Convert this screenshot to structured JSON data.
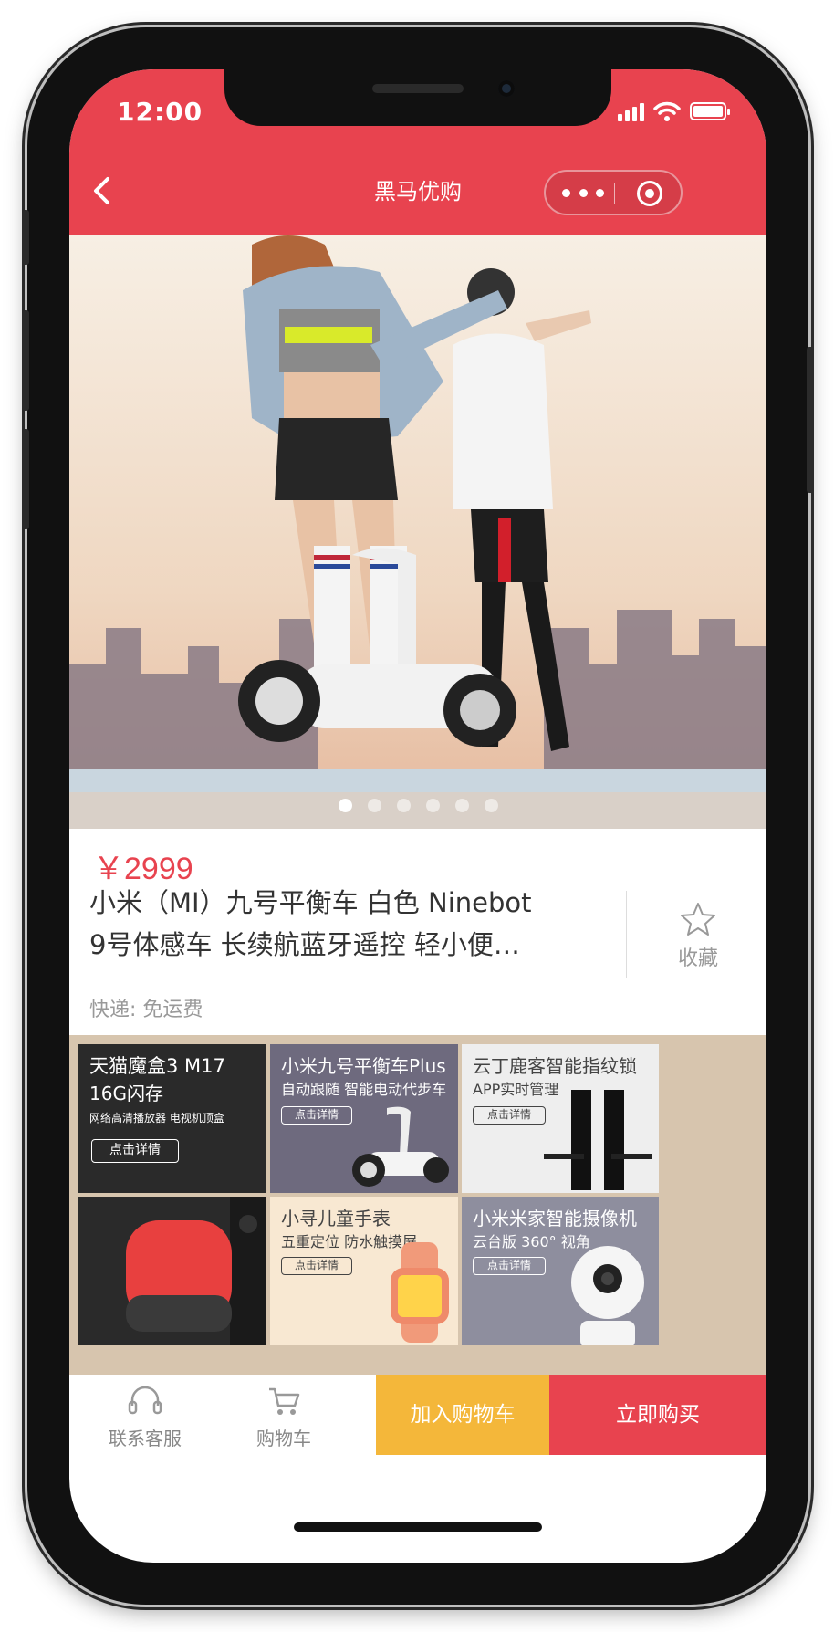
{
  "status_bar": {
    "time": "12:00"
  },
  "nav": {
    "back_icon": "chevron-left-icon",
    "title": "黑马优购",
    "more_icon": "more-dots-icon",
    "close_icon": "target-icon"
  },
  "banner": {
    "image": "photo-two-people-riding-self-balancing-scooters-city-skyline",
    "dots_count": 6,
    "active_dot": 1
  },
  "product": {
    "price": "￥2999",
    "name_line1": "小米（MI）九号平衡车 白色 Ninebot",
    "name_line2": "9号体感车 长续航蓝牙遥控 轻小便…",
    "favorite_label": "收藏",
    "shipping": "快递: 免运费"
  },
  "detail_tiles": [
    {
      "title": "天猫魔盒3 M17",
      "subtitle": "16G闪存",
      "caption": "网络高清播放器 电视机顶盒",
      "button": "点击详情"
    },
    {
      "title": "小米九号平衡车Plus",
      "subtitle": "自动跟随 智能电动代步车",
      "button": "点击详情"
    },
    {
      "title": "云丁鹿客智能指纹锁",
      "subtitle": "APP实时管理",
      "button": "点击详情"
    },
    {
      "title": "",
      "subtitle": ""
    },
    {
      "title": "小寻儿童手表",
      "subtitle": "五重定位 防水触摸屏",
      "button": "点击详情"
    },
    {
      "title": "小米米家智能摄像机",
      "subtitle": "云台版 360° 视角",
      "button": "点击详情"
    }
  ],
  "bottom_bar": {
    "service_label": "联系客服",
    "cart_label": "购物车",
    "add_to_cart": "加入购物车",
    "buy_now": "立即购买"
  },
  "colors": {
    "brand": "#e8434f",
    "cart_button": "#f4b73a"
  }
}
